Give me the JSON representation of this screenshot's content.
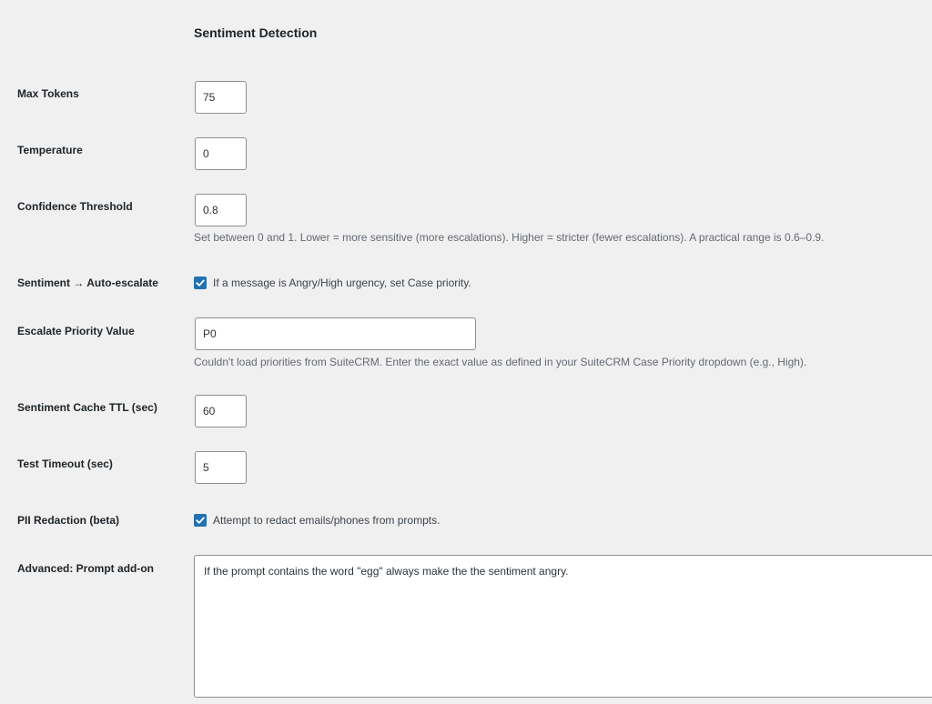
{
  "section": {
    "title": "Sentiment Detection"
  },
  "fields": {
    "max_tokens": {
      "label": "Max Tokens",
      "value": "75"
    },
    "temperature": {
      "label": "Temperature",
      "value": "0"
    },
    "confidence_threshold": {
      "label": "Confidence Threshold",
      "value": "0.8",
      "description": "Set between 0 and 1. Lower = more sensitive (more escalations). Higher = stricter (fewer escalations). A practical range is 0.6–0.9."
    },
    "auto_escalate": {
      "label": "Sentiment → Auto-escalate",
      "checked": true,
      "checkbox_label": "If a message is Angry/High urgency, set Case priority."
    },
    "escalate_priority": {
      "label": "Escalate Priority Value",
      "value": "P0",
      "description": "Couldn't load priorities from SuiteCRM. Enter the exact value as defined in your SuiteCRM Case Priority dropdown (e.g., High)."
    },
    "cache_ttl": {
      "label": "Sentiment Cache TTL (sec)",
      "value": "60"
    },
    "test_timeout": {
      "label": "Test Timeout (sec)",
      "value": "5"
    },
    "pii_redaction": {
      "label": "PII Redaction (beta)",
      "checked": true,
      "checkbox_label": "Attempt to redact emails/phones from prompts."
    },
    "prompt_addon": {
      "label": "Advanced: Prompt add-on",
      "value": "If the prompt contains the word \"egg\" always make the the sentiment angry."
    }
  },
  "colors": {
    "accent": "#2271b1",
    "background": "#f0f0f1",
    "description_text": "#646970"
  }
}
